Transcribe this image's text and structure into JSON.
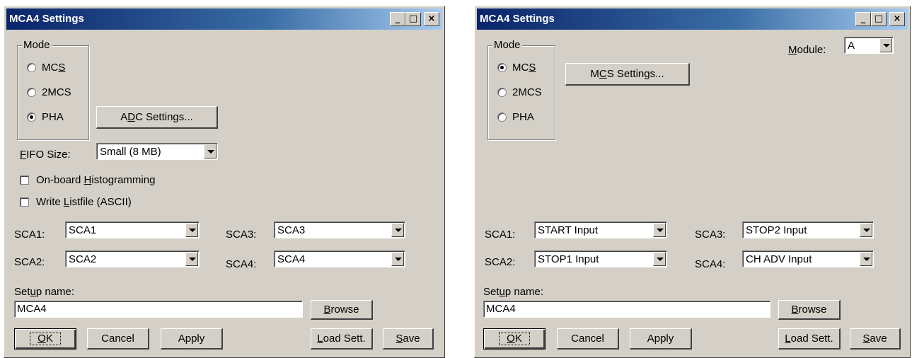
{
  "window_left": {
    "title": "MCA4 Settings",
    "controls": {
      "minimize": "_",
      "maximize": "□",
      "close": "×"
    },
    "mode_label": "Mode",
    "modes": [
      {
        "pre": "MC",
        "key": "S",
        "post": ""
      },
      {
        "pre": "2MCS",
        "key": "",
        "post": ""
      },
      {
        "pre": "PHA",
        "key": "",
        "post": ""
      }
    ],
    "selected_mode": "PHA",
    "adc_button": {
      "pre": "A",
      "key": "D",
      "post": "C Settings..."
    },
    "fifo": {
      "pre": "",
      "key": "F",
      "post": "IFO Size:",
      "value": "Small   (8 MB)"
    },
    "onboard": {
      "pre": "On-board ",
      "key": "H",
      "post": "istogramming"
    },
    "listfile": {
      "pre": "Write ",
      "key": "L",
      "post": "istfile (ASCII)"
    },
    "sca": {
      "sca1_label": "SCA1:",
      "sca1_value": "SCA1",
      "sca2_label": "SCA2:",
      "sca2_value": "SCA2",
      "sca3_label": "SCA3:",
      "sca3_value": "SCA3",
      "sca4_label": "SCA4:",
      "sca4_value": "SCA4"
    },
    "setup": {
      "pre": "Set",
      "key": "u",
      "post": "p name:",
      "value": "MCA4"
    },
    "browse": {
      "pre": "",
      "key": "B",
      "post": "rowse"
    },
    "ok": {
      "pre": "",
      "key": "O",
      "post": "K"
    },
    "cancel": "Cancel",
    "apply": "Apply",
    "load": {
      "pre": "",
      "key": "L",
      "post": "oad Sett."
    },
    "save": {
      "pre": "",
      "key": "S",
      "post": "ave"
    }
  },
  "window_right": {
    "title": "MCA4 Settings",
    "controls": {
      "minimize": "_",
      "maximize": "□",
      "close": "×"
    },
    "mode_label": "Mode",
    "modes": [
      {
        "pre": "MC",
        "key": "S",
        "post": ""
      },
      {
        "pre": "2MCS",
        "key": "",
        "post": ""
      },
      {
        "pre": "PHA",
        "key": "",
        "post": ""
      }
    ],
    "selected_mode": "MCS",
    "module": {
      "pre": "",
      "key": "M",
      "post": "odule:",
      "value": "A"
    },
    "mcs_button": {
      "pre": "M",
      "key": "C",
      "post": "S Settings..."
    },
    "sca": {
      "sca1_label": "SCA1:",
      "sca1_value": "START Input",
      "sca2_label": "SCA2:",
      "sca2_value": "STOP1 Input",
      "sca3_label": "SCA3:",
      "sca3_value": "STOP2 Input",
      "sca4_label": "SCA4:",
      "sca4_value": "CH ADV Input"
    },
    "setup": {
      "pre": "Set",
      "key": "u",
      "post": "p name:",
      "value": "MCA4"
    },
    "browse": {
      "pre": "",
      "key": "B",
      "post": "rowse"
    },
    "ok": {
      "pre": "",
      "key": "O",
      "post": "K"
    },
    "cancel": "Cancel",
    "apply": "Apply",
    "load": {
      "pre": "",
      "key": "L",
      "post": "oad Sett."
    },
    "save": {
      "pre": "",
      "key": "S",
      "post": "ave"
    }
  }
}
